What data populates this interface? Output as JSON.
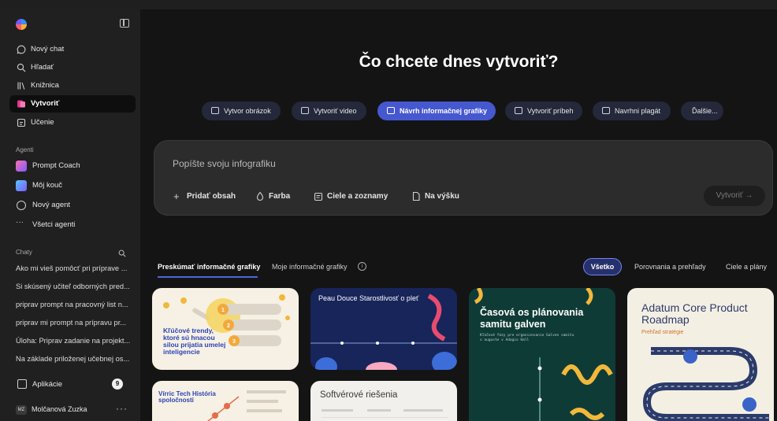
{
  "sidebar": {
    "nav": [
      {
        "label": "Nový chat",
        "icon": "chat-bubble-icon"
      },
      {
        "label": "Hľadať",
        "icon": "search-icon"
      },
      {
        "label": "Knižnica",
        "icon": "library-icon"
      },
      {
        "label": "Vytvoriť",
        "icon": "create-icon"
      },
      {
        "label": "Učenie",
        "icon": "learning-icon"
      }
    ],
    "agents_label": "Agenti",
    "agents": [
      {
        "label": "Prompt Coach"
      },
      {
        "label": "Môj kouč"
      },
      {
        "label": "Nový agent"
      },
      {
        "label": "Všetci agenti"
      }
    ],
    "chats_label": "Chaty",
    "chats": [
      "Ako mi vieš pomôcť pri príprave ...",
      "Si skúsený učiteľ odborných pred...",
      "priprav prompt na pracovný list n...",
      "priprav mi prompt na prípravu pr...",
      "Úloha: Priprav zadanie na projekt...",
      "Na základe priloženej učebnej os..."
    ],
    "apps_label": "Aplikácie",
    "apps_badge": "9",
    "user_initials": "MZ",
    "user_name": "Molčanová Zuzka"
  },
  "main": {
    "title": "Čo chcete dnes vytvoriť?",
    "chips": [
      {
        "label": "Vytvor obrázok"
      },
      {
        "label": "Vytvoriť video"
      },
      {
        "label": "Návrh informačnej grafiky"
      },
      {
        "label": "Vytvoriť príbeh"
      },
      {
        "label": "Navrhni plagát"
      },
      {
        "label": "Ďalšie..."
      }
    ],
    "prompt_placeholder": "Popíšte svoju infografiku",
    "tools": [
      {
        "label": "Pridať obsah"
      },
      {
        "label": "Farba"
      },
      {
        "label": "Ciele a zoznamy"
      },
      {
        "label": "Na výšku"
      }
    ],
    "create_label": "Vytvoriť →",
    "tabs": [
      {
        "label": "Preskúmať informačné grafiky"
      },
      {
        "label": "Moje informačné grafiky"
      }
    ],
    "filters": [
      {
        "label": "Všetko"
      },
      {
        "label": "Porovnania a prehľady"
      },
      {
        "label": "Ciele a plány"
      }
    ],
    "cards": [
      {
        "title": "Kľúčové trendy, ktoré sú hnacou silou prijatia umelej inteligencie"
      },
      {
        "title": "Peau Douce Starostlivosť o pleť"
      },
      {
        "title": "Časová os plánovania samitu galven",
        "subtitle": "Kľúčové fázy pre organizovanie Galven samitu v auguste v Adagio Hall"
      },
      {
        "title": "Adatum Core Product Roadmap",
        "subtitle": "Prehľad stratégie"
      },
      {
        "title": "Vírric Tech História spoločnosti"
      },
      {
        "title": "Softvérové riešenia"
      }
    ]
  },
  "colors": {
    "accent": "#4658d0",
    "sidebar_bg": "#202020",
    "main_bg": "#141414"
  }
}
